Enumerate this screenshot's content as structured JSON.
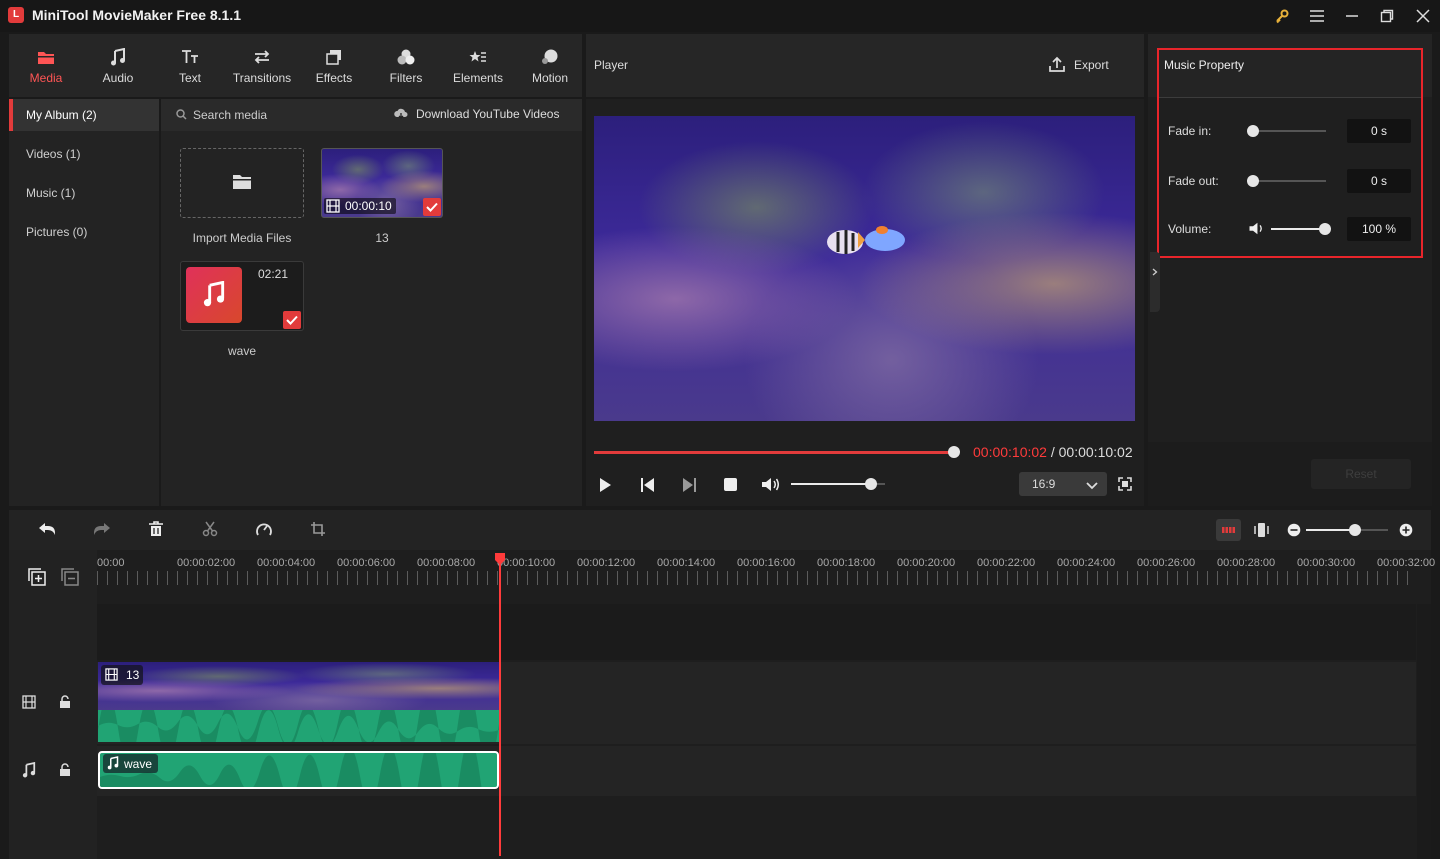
{
  "app": {
    "title": "MiniTool MovieMaker Free 8.1.1",
    "logo_letter": "L"
  },
  "tools": [
    {
      "label": "Media",
      "icon": "media-icon",
      "active": true
    },
    {
      "label": "Audio",
      "icon": "music-note-icon",
      "active": false
    },
    {
      "label": "Text",
      "icon": "text-icon",
      "active": false
    },
    {
      "label": "Transitions",
      "icon": "transitions-icon",
      "active": false
    },
    {
      "label": "Effects",
      "icon": "effects-icon",
      "active": false
    },
    {
      "label": "Filters",
      "icon": "filters-icon",
      "active": false
    },
    {
      "label": "Elements",
      "icon": "elements-icon",
      "active": false
    },
    {
      "label": "Motion",
      "icon": "motion-icon",
      "active": false
    }
  ],
  "album": {
    "items": [
      {
        "label": "My Album (2)"
      },
      {
        "label": "Videos (1)"
      },
      {
        "label": "Music (1)"
      },
      {
        "label": "Pictures (0)"
      }
    ]
  },
  "media": {
    "search_label": "Search media",
    "download_label": "Download YouTube Videos",
    "import_label": "Import Media Files",
    "video": {
      "name": "13",
      "duration": "00:00:10"
    },
    "audio": {
      "name": "wave",
      "duration": "02:21"
    }
  },
  "player": {
    "title": "Player",
    "export_label": "Export",
    "current_time": "00:00:10:02",
    "separator": " / ",
    "total_time": "00:00:10:02",
    "aspect_ratio": "16:9",
    "progress": 1.0,
    "volume": 0.85
  },
  "property": {
    "title": "Music Property",
    "fade_in_label": "Fade in:",
    "fade_in_value": "0 s",
    "fade_out_label": "Fade out:",
    "fade_out_value": "0 s",
    "volume_label": "Volume:",
    "volume_value": "100 %",
    "reset_label": "Reset"
  },
  "timeline": {
    "ruler": [
      "00:00",
      "00:00:02:00",
      "00:00:04:00",
      "00:00:06:00",
      "00:00:08:00",
      "00:00:10:00",
      "00:00:12:00",
      "00:00:14:00",
      "00:00:16:00",
      "00:00:18:00",
      "00:00:20:00",
      "00:00:22:00",
      "00:00:24:00",
      "00:00:26:00",
      "00:00:28:00",
      "00:00:30:00",
      "00:00:32:00"
    ],
    "video_clip_label": "13",
    "audio_clip_label": "wave",
    "zoom": 0.6
  },
  "colors": {
    "accent": "#e23b3b",
    "clip_green": "#21a474",
    "highlight_red": "#ff3b3b"
  }
}
